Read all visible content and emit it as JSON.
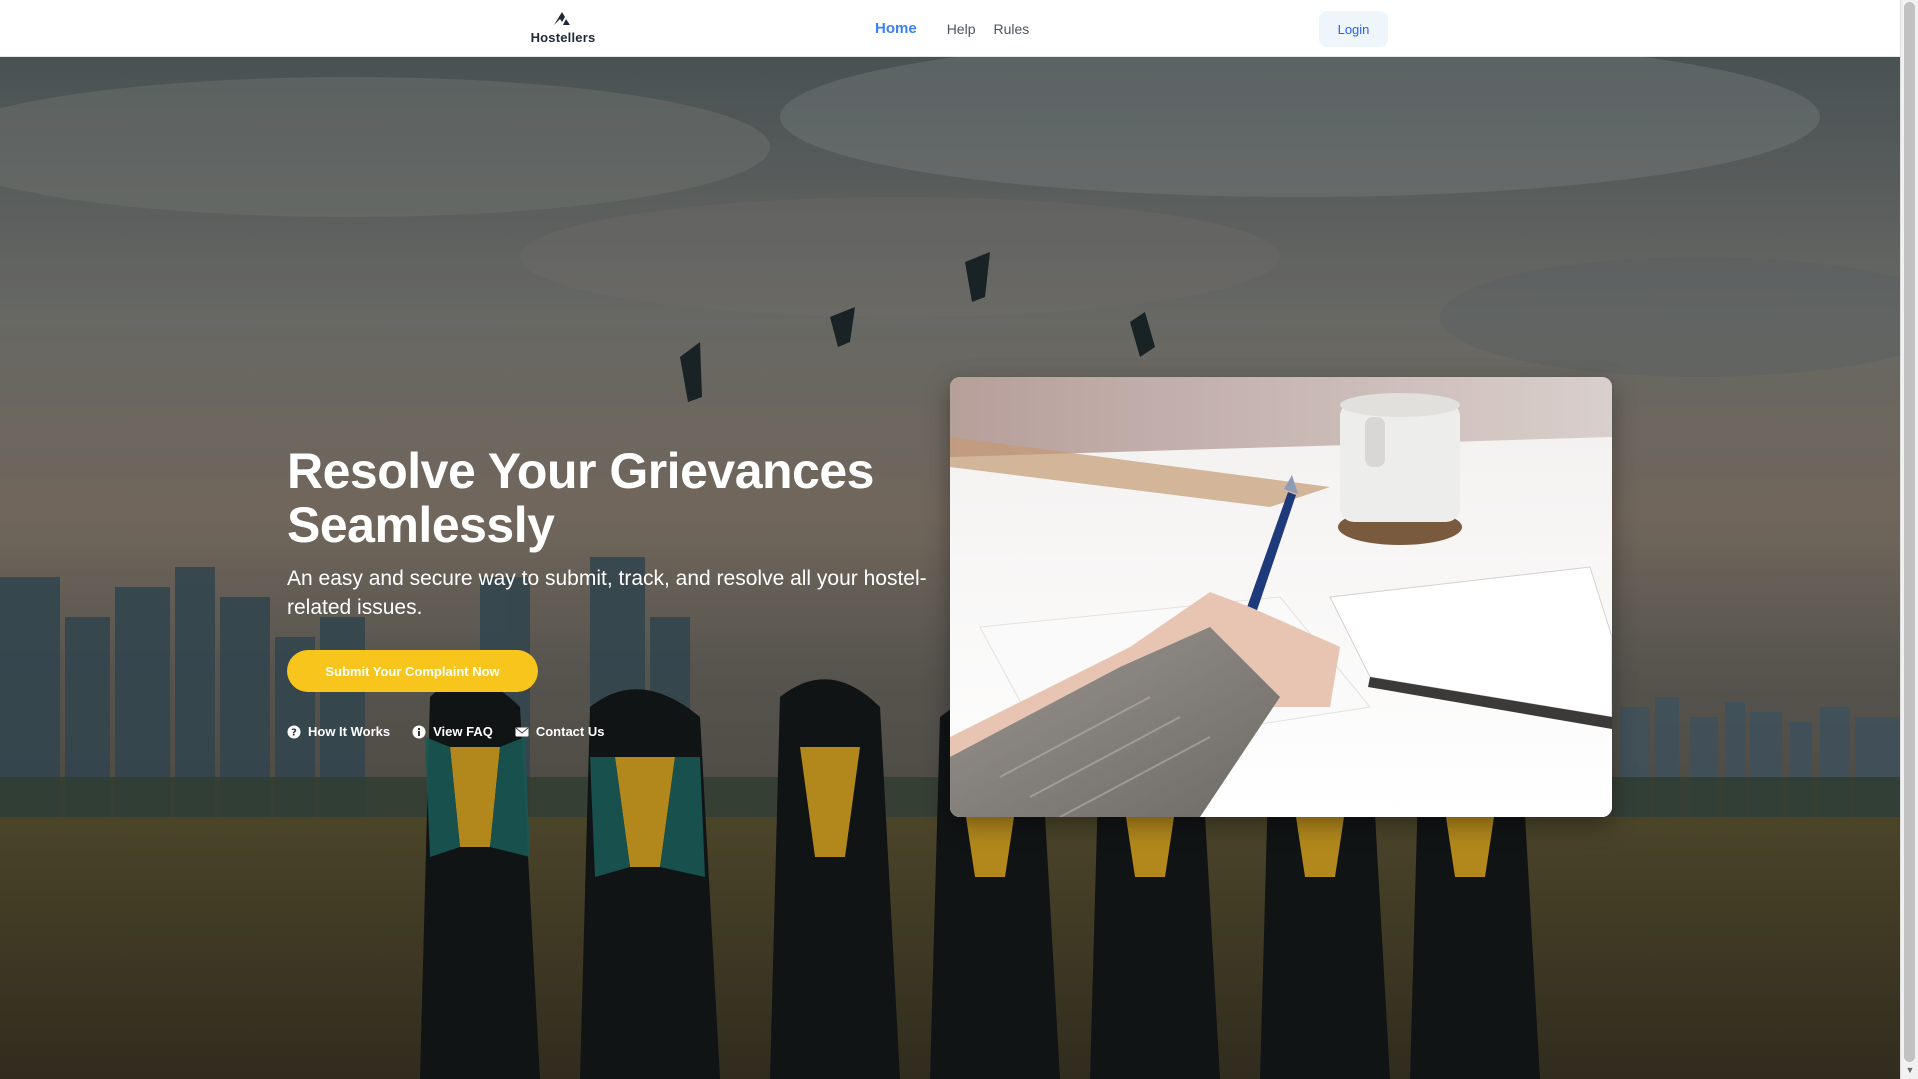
{
  "brand": {
    "name": "Hostellers",
    "logo_icon": "mountain-logo-icon"
  },
  "nav": {
    "items": [
      {
        "label": "Home",
        "active": true
      },
      {
        "label": "Help",
        "active": false
      },
      {
        "label": "Rules",
        "active": false
      }
    ],
    "login_label": "Login"
  },
  "hero": {
    "title": "Resolve Your Grievances Seamlessly",
    "subtitle": "An easy and secure way to submit, track, and resolve all your hostel-related issues.",
    "cta_label": "Submit Your Complaint Now",
    "links": [
      {
        "label": "How It Works",
        "icon": "question-circle-icon"
      },
      {
        "label": "View FAQ",
        "icon": "info-circle-icon"
      },
      {
        "label": "Contact Us",
        "icon": "envelope-icon"
      }
    ],
    "background_image": "graduates-throwing-caps-photo",
    "side_image": "hand-writing-with-pen-photo"
  },
  "colors": {
    "accent_blue": "#3b82f6",
    "cta_yellow": "#f7c51b",
    "login_bg": "#eef6fb",
    "login_text": "#2563eb"
  }
}
